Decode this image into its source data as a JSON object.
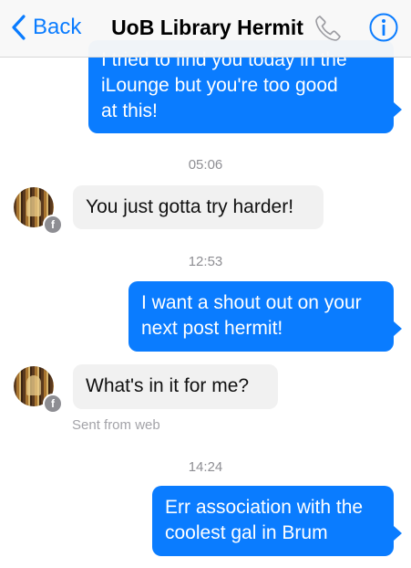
{
  "header": {
    "back_label": "Back",
    "title": "UoB Library Hermit",
    "phone_icon": "phone-icon",
    "info_icon": "info-icon"
  },
  "colors": {
    "accent": "#0a7cff",
    "incoming_bubble": "#f1f1f1",
    "timestamp": "#8e8e93"
  },
  "messages": [
    {
      "type": "outgoing",
      "lines": [
        "I tried to find you today in the",
        "iLounge but you're too good",
        "at this!"
      ]
    },
    {
      "type": "timestamp",
      "text": "05:06"
    },
    {
      "type": "incoming",
      "text": "You just gotta try harder!"
    },
    {
      "type": "timestamp",
      "text": "12:53"
    },
    {
      "type": "outgoing",
      "lines": [
        "I want a shout out on your",
        "next post hermit!"
      ]
    },
    {
      "type": "incoming",
      "text": "What's in it for me?",
      "meta": "Sent from web"
    },
    {
      "type": "timestamp",
      "text": "14:24"
    },
    {
      "type": "outgoing",
      "lines": [
        "Err association with the",
        "coolest gal in Brum"
      ]
    }
  ],
  "avatar_badge": "f"
}
